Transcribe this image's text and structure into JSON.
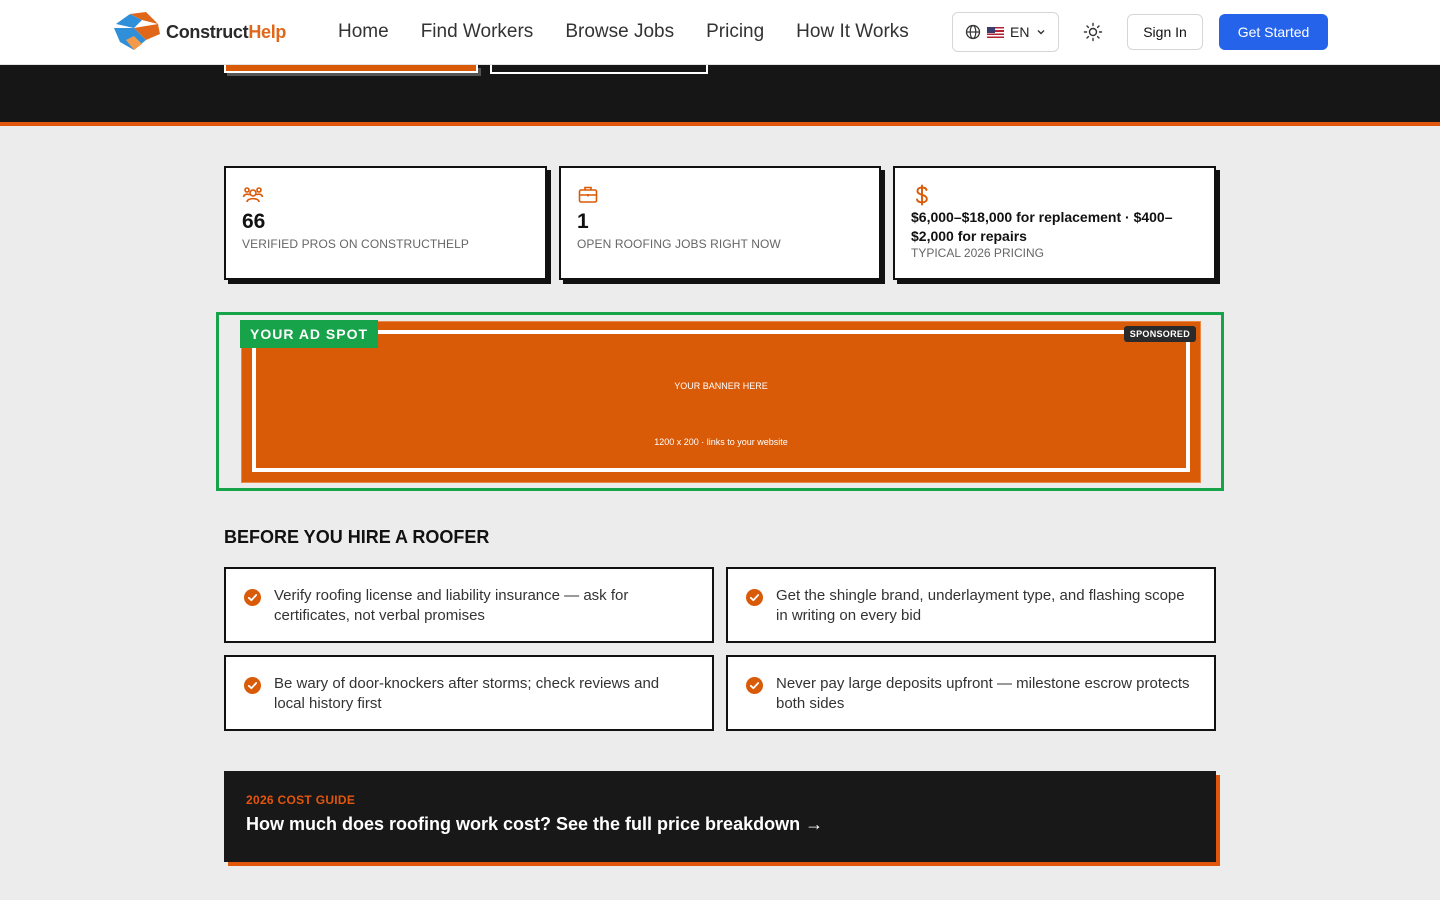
{
  "brand": {
    "name_part1": "Construct",
    "name_part2": "Help"
  },
  "nav": [
    {
      "label": "Home"
    },
    {
      "label": "Find Workers"
    },
    {
      "label": "Browse Jobs"
    },
    {
      "label": "Pricing"
    },
    {
      "label": "How It Works"
    }
  ],
  "header": {
    "language": "EN",
    "sign_in": "Sign In",
    "get_started": "Get Started"
  },
  "stats": [
    {
      "icon": "users-icon",
      "value": "66",
      "label": "Verified pros on ConstructHelp"
    },
    {
      "icon": "briefcase-icon",
      "value": "1",
      "label": "Open roofing jobs right now"
    },
    {
      "icon": "dollar-icon",
      "value": "$6,000–$18,000 for replacement · $400–$2,000 for repairs",
      "label": "Typical 2026 pricing"
    }
  ],
  "ad": {
    "tag": "YOUR AD SPOT",
    "sponsored": "SPONSORED",
    "banner_text": "YOUR BANNER HERE",
    "banner_sub": "1200 x 200 · links to your website"
  },
  "tips": {
    "title": "BEFORE YOU HIRE A ROOFER",
    "items": [
      "Verify roofing license and liability insurance — ask for certificates, not verbal promises",
      "Get the shingle brand, underlayment type, and flashing scope in writing on every bid",
      "Be wary of door-knockers after storms; check reviews and local history first",
      "Never pay large deposits upfront — milestone escrow protects both sides"
    ]
  },
  "guide": {
    "kicker": "2026 COST GUIDE",
    "headline": "How much does roofing work cost? See the full price breakdown →"
  },
  "colors": {
    "accent_orange": "#e2560c",
    "primary_blue": "#2563eb",
    "ad_green": "#16a34a",
    "dark": "#161616"
  }
}
